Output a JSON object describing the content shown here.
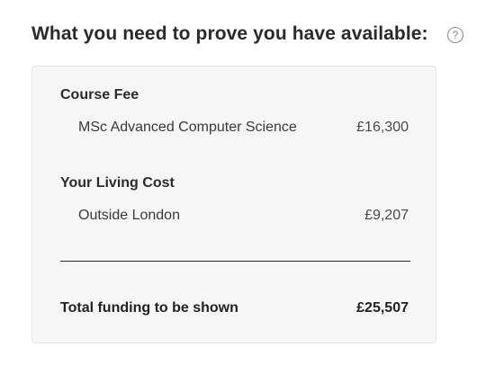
{
  "heading": "What you need to prove you have available:",
  "help_icon": {
    "glyph": "?",
    "name": "question-circle-icon"
  },
  "funding": {
    "course_fee": {
      "title": "Course Fee",
      "item_label": "MSc Advanced Computer Science",
      "item_value": "£16,300"
    },
    "living_cost": {
      "title": "Your Living Cost",
      "item_label": "Outside London",
      "item_value": "£9,207"
    },
    "total": {
      "label": "Total funding to be shown",
      "value": "£25,507"
    }
  },
  "colors": {
    "card_background": "#f6f6f7",
    "text": "#2b2b2b",
    "icon": "#8a8a8a"
  }
}
